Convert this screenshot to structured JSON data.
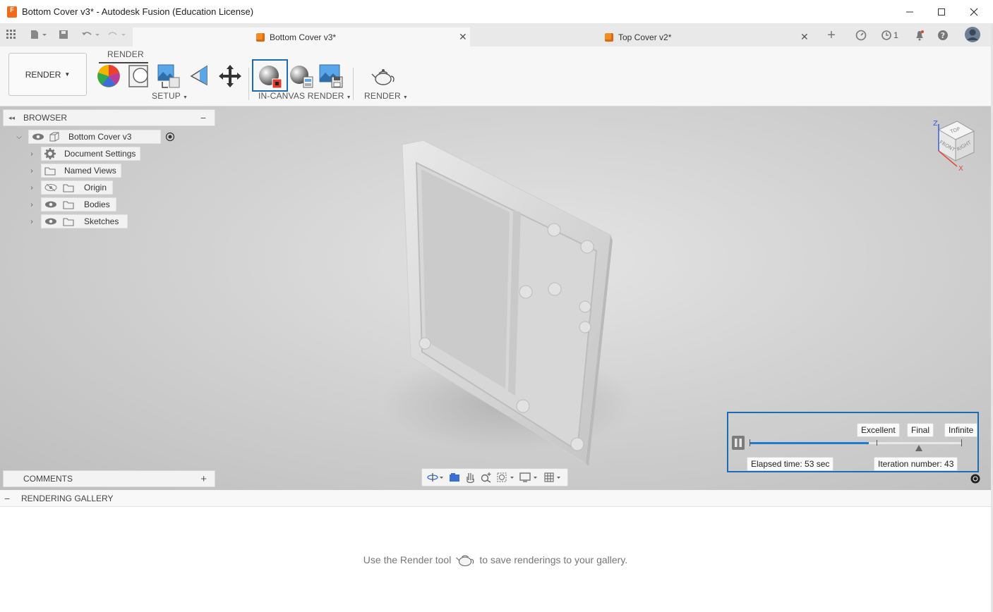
{
  "window": {
    "title": "Bottom Cover v3* - Autodesk Fusion (Education License)",
    "app_icon_letter": "F"
  },
  "tabs": [
    {
      "label": "Bottom Cover v3*",
      "active": true
    },
    {
      "label": "Top Cover v2*",
      "active": false
    }
  ],
  "header_right": {
    "job_count": "1"
  },
  "toolbar": {
    "workspace_label": "RENDER",
    "tab_label": "RENDER",
    "groups": {
      "setup": "SETUP",
      "in_canvas_render": "IN-CANVAS RENDER",
      "render": "RENDER"
    }
  },
  "browser": {
    "title": "BROWSER",
    "root": "Bottom Cover v3",
    "items": [
      {
        "label": "Document Settings"
      },
      {
        "label": "Named Views"
      },
      {
        "label": "Origin"
      },
      {
        "label": "Bodies"
      },
      {
        "label": "Sketches"
      }
    ]
  },
  "comments": {
    "title": "COMMENTS"
  },
  "viewcube": {
    "top": "TOP",
    "front": "FRONT",
    "right": "RIGHT",
    "axis_z": "Z",
    "axis_x": "X"
  },
  "render_progress": {
    "progress_fraction": 0.56,
    "markers": [
      "Excellent",
      "Final",
      "Infinite"
    ],
    "elapsed": "Elapsed time: 53 sec",
    "iteration": "Iteration number: 43"
  },
  "gallery": {
    "title": "RENDERING GALLERY",
    "message_before": "Use the Render tool",
    "message_after": "to save renderings to your gallery."
  },
  "colors": {
    "accent": "#1c6bb5",
    "progress": "#1f7ad1",
    "brand": "#f26b1d"
  }
}
